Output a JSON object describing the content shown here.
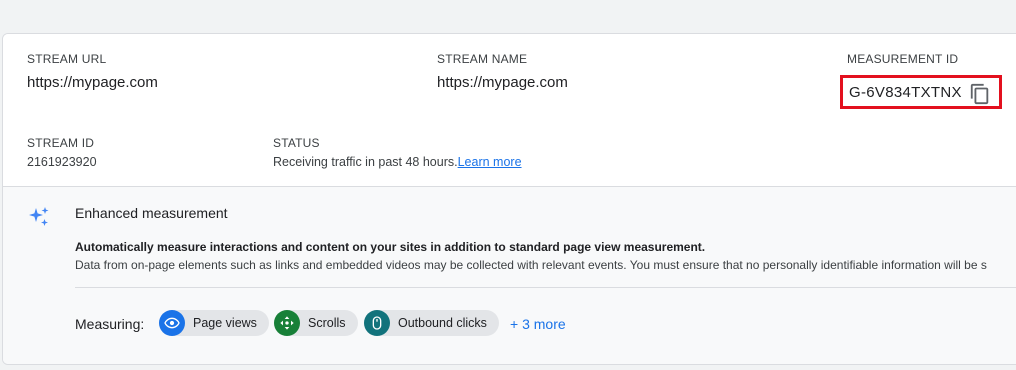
{
  "stream": {
    "url_label": "STREAM URL",
    "url_value": "https://mypage.com",
    "name_label": "STREAM NAME",
    "name_value": "https://mypage.com",
    "mid_label": "MEASUREMENT ID",
    "mid_value": "G-6V834TXTNX",
    "id_label": "STREAM ID",
    "id_value": "2161923920",
    "status_label": "STATUS",
    "status_value": "Receiving traffic in past 48 hours.",
    "status_link": "Learn more"
  },
  "enhanced": {
    "title": "Enhanced measurement",
    "desc_bold": "Automatically measure interactions and content on your sites in addition to standard page view measurement.",
    "desc": "Data from on-page elements such as links and embedded videos may be collected with relevant events. You must ensure that no personally identifiable information will be s",
    "measuring_label": "Measuring:",
    "chips": [
      {
        "label": "Page views",
        "icon": "eye-icon",
        "color": "#1a73e8"
      },
      {
        "label": "Scrolls",
        "icon": "scroll-arrows-icon",
        "color": "#188038"
      },
      {
        "label": "Outbound clicks",
        "icon": "mouse-icon",
        "color": "#12737c"
      }
    ],
    "more": "+ 3 more"
  },
  "colors": {
    "highlight_border": "#e3101e",
    "link": "#1a73e8",
    "sparkle": "#4285f4"
  }
}
